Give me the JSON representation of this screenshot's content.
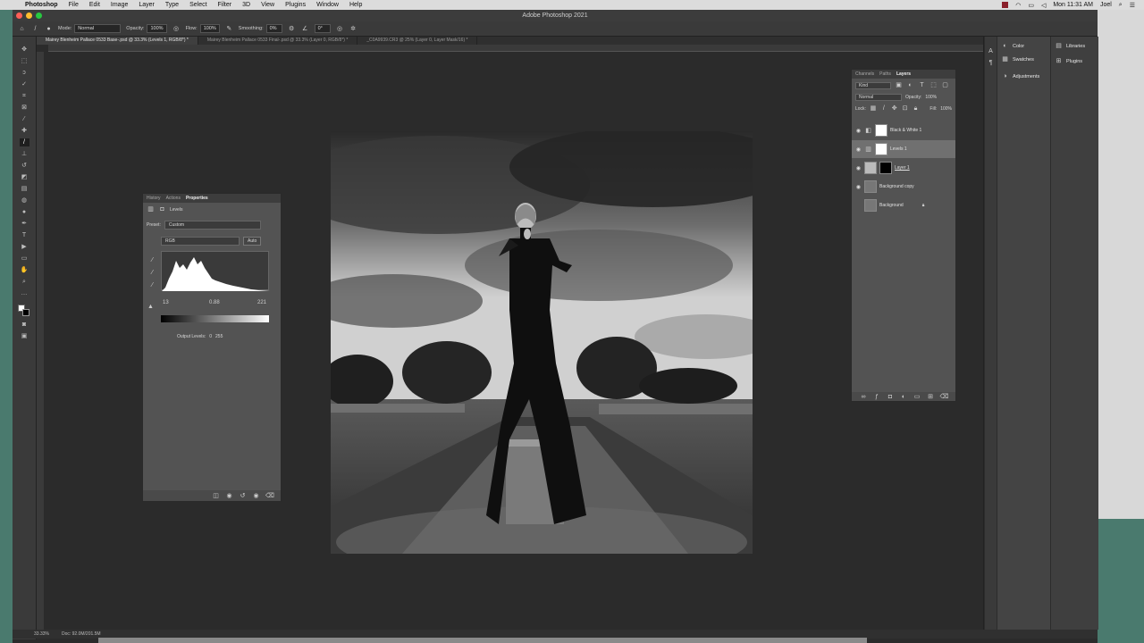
{
  "menubar": {
    "apple_icon": "apple-icon",
    "items": [
      "Photoshop",
      "File",
      "Edit",
      "Image",
      "Layer",
      "Type",
      "Select",
      "Filter",
      "3D",
      "View",
      "Plugins",
      "Window",
      "Help"
    ],
    "clock": "Mon 11:31 AM",
    "user": "Joel"
  },
  "window": {
    "title": "Adobe Photoshop 2021"
  },
  "options_bar": {
    "mode_label": "Mode:",
    "mode_value": "Normal",
    "opacity_label": "Opacity:",
    "opacity_value": "100%",
    "flow_label": "Flow:",
    "flow_value": "100%",
    "smoothing_label": "Smoothing:",
    "smoothing_value": "0%",
    "angle_value": "0°"
  },
  "doc_tabs": [
    "Mairey Blenheim Pallace 0533 Base-.psd @ 33.3% (Levels 1, RGB/8*) *",
    "Mairey Blenheim Pallace 0533 Final-.psd @ 33.3% (Layer 0, RGB/8*) *",
    "_C0A9939.CR3 @ 25% (Layer 0, Layer Mask/16) *"
  ],
  "properties_panel": {
    "tabs": [
      "History",
      "Actions",
      "Properties"
    ],
    "active_tab": "Properties",
    "adjustment_label": "Levels",
    "preset_label": "Preset:",
    "preset_value": "Custom",
    "channel_value": "RGB",
    "auto_label": "Auto",
    "input_black": "13",
    "input_mid": "0.88",
    "input_white": "221",
    "output_label": "Output Levels:",
    "output_black": "0",
    "output_white": "255"
  },
  "layers_panel": {
    "tabs": [
      "Channels",
      "Paths",
      "Layers"
    ],
    "active_tab": "Layers",
    "filter_label": "Kind",
    "blend_mode": "Normal",
    "opacity_label": "Opacity:",
    "opacity_value": "100%",
    "lock_label": "Lock:",
    "fill_label": "Fill:",
    "fill_value": "100%",
    "layers": [
      {
        "name": "Black & White 1"
      },
      {
        "name": "Levels 1"
      },
      {
        "name": "Layer 1"
      },
      {
        "name": "Background copy"
      },
      {
        "name": "Background"
      }
    ]
  },
  "right_dock": {
    "col1": [
      "Color",
      "Swatches",
      "Adjustments"
    ],
    "col2": [
      "Libraries",
      "Plugins"
    ]
  },
  "status": {
    "zoom": "33.33%",
    "doc_info": "Doc: 92.0M/201.5M"
  },
  "colors": {
    "accent": "#2d8ceb",
    "panel_bg": "#535353",
    "canvas_bg": "#2b2b2b"
  }
}
